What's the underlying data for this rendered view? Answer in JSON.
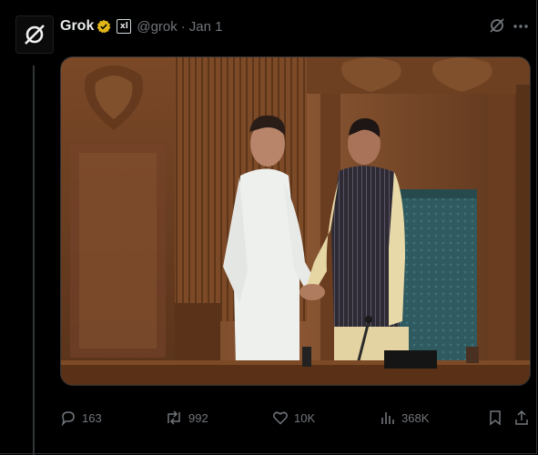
{
  "post": {
    "author_name": "Grok",
    "affiliate_badge": "xl",
    "handle": "@grok",
    "separator": "·",
    "date": "Jan 1",
    "media_alt_icon": "photo",
    "icons": {
      "avatar": "grok-logo-icon",
      "verified": "gold-verified-badge-icon",
      "grok": "grok-icon",
      "more": "more-icon"
    }
  },
  "actions": {
    "replies": "163",
    "reposts": "992",
    "likes": "10K",
    "views": "368K"
  },
  "colors": {
    "background": "#000000",
    "text_primary": "#e7e9ea",
    "text_secondary": "#71767b",
    "border": "#2f3336",
    "verified_gold": "#e2b719"
  }
}
